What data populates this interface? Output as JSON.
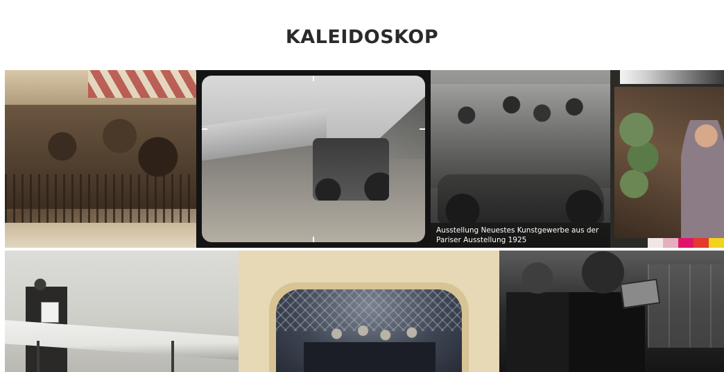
{
  "page": {
    "title": "KALEIDOSKOP"
  },
  "gallery": {
    "tiles": [
      {
        "id": "balcony-crowd",
        "caption": ""
      },
      {
        "id": "race-car",
        "caption": ""
      },
      {
        "id": "car-group",
        "caption": "Ausstellung Neuestes Kunstgewerbe aus der Pariser Ausstellung 1925"
      },
      {
        "id": "colour-portrait",
        "caption": ""
      },
      {
        "id": "aviator",
        "caption": ""
      },
      {
        "id": "daguerreotype",
        "caption": ""
      },
      {
        "id": "camera-crew",
        "caption": ""
      }
    ]
  },
  "colors": {
    "title": "#2a2a2a",
    "caption_bg": "rgba(0,0,0,0.55)",
    "caption_text": "#ffffff"
  }
}
